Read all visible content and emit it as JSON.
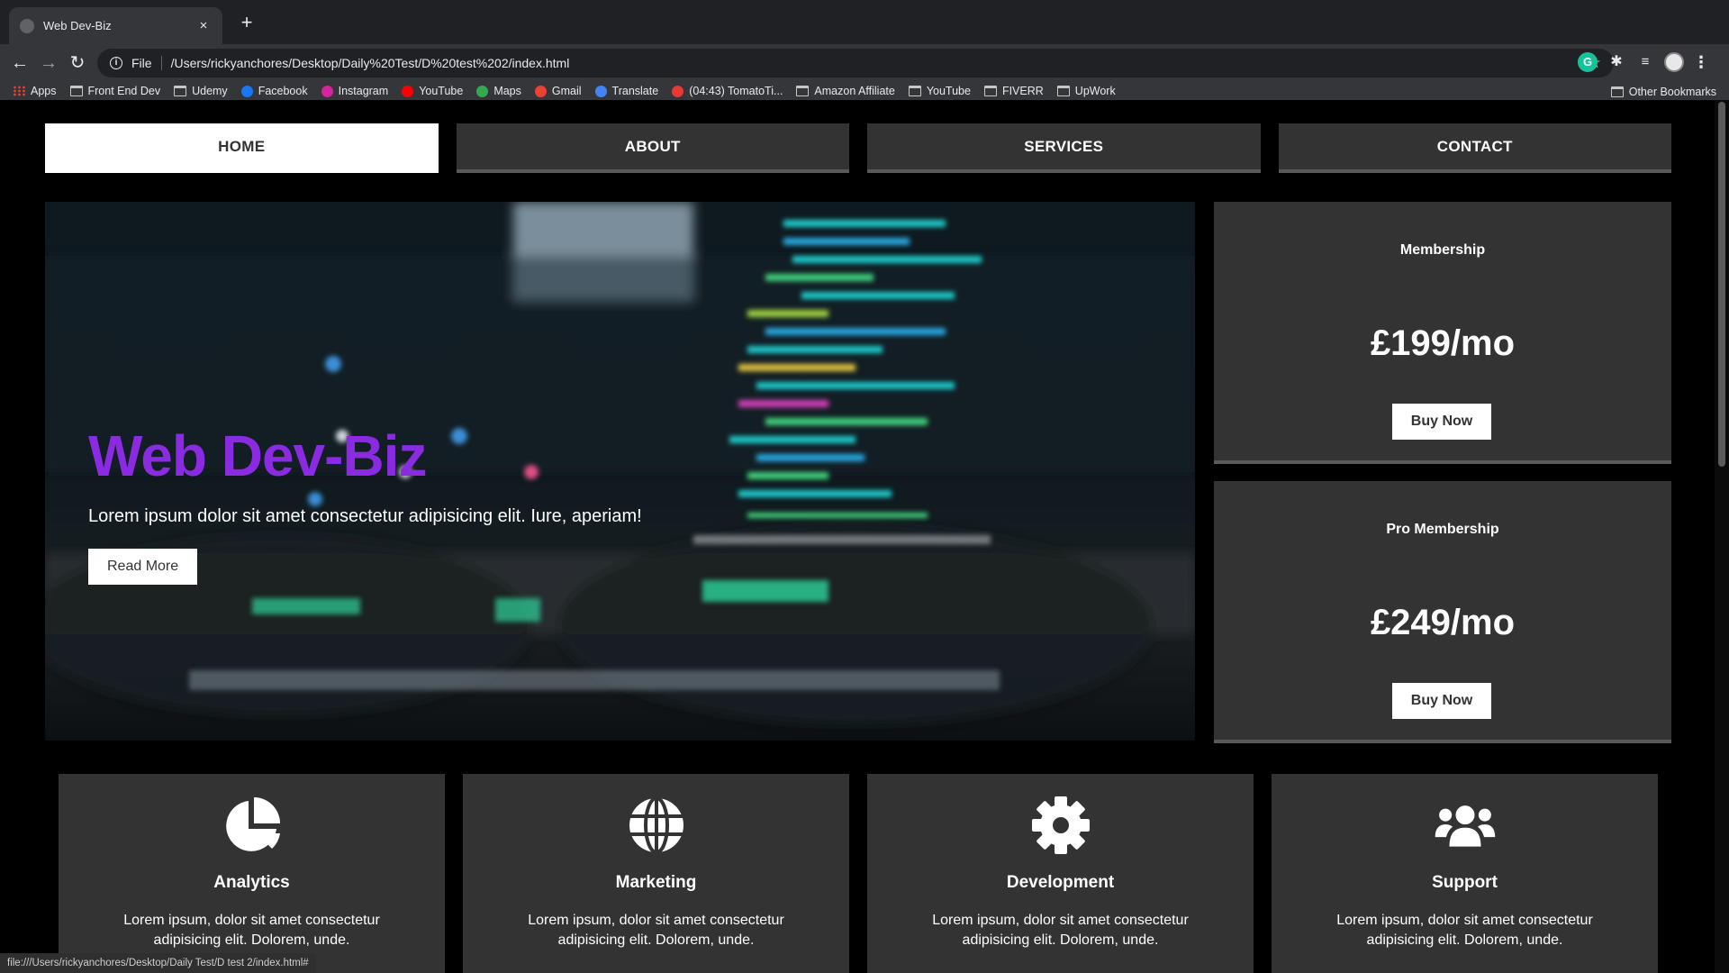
{
  "browser": {
    "tab_title": "Web Dev-Biz",
    "tab_close": "×",
    "new_tab": "+",
    "scheme": "File",
    "url": "/Users/rickyanchores/Desktop/Daily%20Test/D%20test%202/index.html",
    "status_url": "file:///Users/rickyanchores/Desktop/Daily Test/D test 2/index.html#",
    "bookmarks": [
      {
        "label": "Apps",
        "icon": "apps-grid-icon"
      },
      {
        "label": "Front End Dev",
        "icon": "folder-icon"
      },
      {
        "label": "Udemy",
        "icon": "folder-icon"
      },
      {
        "label": "Facebook",
        "icon": "facebook-icon",
        "color": "#1877f2"
      },
      {
        "label": "Instagram",
        "icon": "instagram-icon",
        "color": "#d6249f"
      },
      {
        "label": "YouTube",
        "icon": "youtube-icon",
        "color": "#ff0000"
      },
      {
        "label": "Maps",
        "icon": "maps-icon",
        "color": "#34a853"
      },
      {
        "label": "Gmail",
        "icon": "gmail-icon",
        "color": "#ea4335"
      },
      {
        "label": "Translate",
        "icon": "translate-icon",
        "color": "#4285f4"
      },
      {
        "label": "(04:43) TomatoTi...",
        "icon": "tomato-icon",
        "color": "#e53935"
      },
      {
        "label": "Amazon Affiliate",
        "icon": "folder-icon"
      },
      {
        "label": "YouTube",
        "icon": "folder-icon"
      },
      {
        "label": "FIVERR",
        "icon": "folder-icon"
      },
      {
        "label": "UpWork",
        "icon": "folder-icon"
      }
    ],
    "other_bookmarks": "Other Bookmarks"
  },
  "nav": {
    "items": [
      {
        "label": "HOME",
        "active": true
      },
      {
        "label": "ABOUT",
        "active": false
      },
      {
        "label": "SERVICES",
        "active": false
      },
      {
        "label": "CONTACT",
        "active": false
      }
    ]
  },
  "hero": {
    "title": "Web Dev-Biz",
    "text": "Lorem ipsum dolor sit amet consectetur adipisicing elit. Iure, aperiam!",
    "button": "Read More",
    "title_color": "#8a2be2"
  },
  "pricing": [
    {
      "name": "Membership",
      "price": "£199/mo",
      "button": "Buy Now"
    },
    {
      "name": "Pro Membership",
      "price": "£249/mo",
      "button": "Buy Now"
    }
  ],
  "features": [
    {
      "icon": "pie-chart-icon",
      "title": "Analytics",
      "text": "Lorem ipsum, dolor sit amet consectetur adipisicing elit. Dolorem, unde."
    },
    {
      "icon": "globe-icon",
      "title": "Marketing",
      "text": "Lorem ipsum, dolor sit amet consectetur adipisicing elit. Dolorem, unde."
    },
    {
      "icon": "gear-icon",
      "title": "Development",
      "text": "Lorem ipsum, dolor sit amet consectetur adipisicing elit. Dolorem, unde."
    },
    {
      "icon": "users-icon",
      "title": "Support",
      "text": "Lorem ipsum, dolor sit amet consectetur adipisicing elit. Dolorem, unde."
    }
  ]
}
